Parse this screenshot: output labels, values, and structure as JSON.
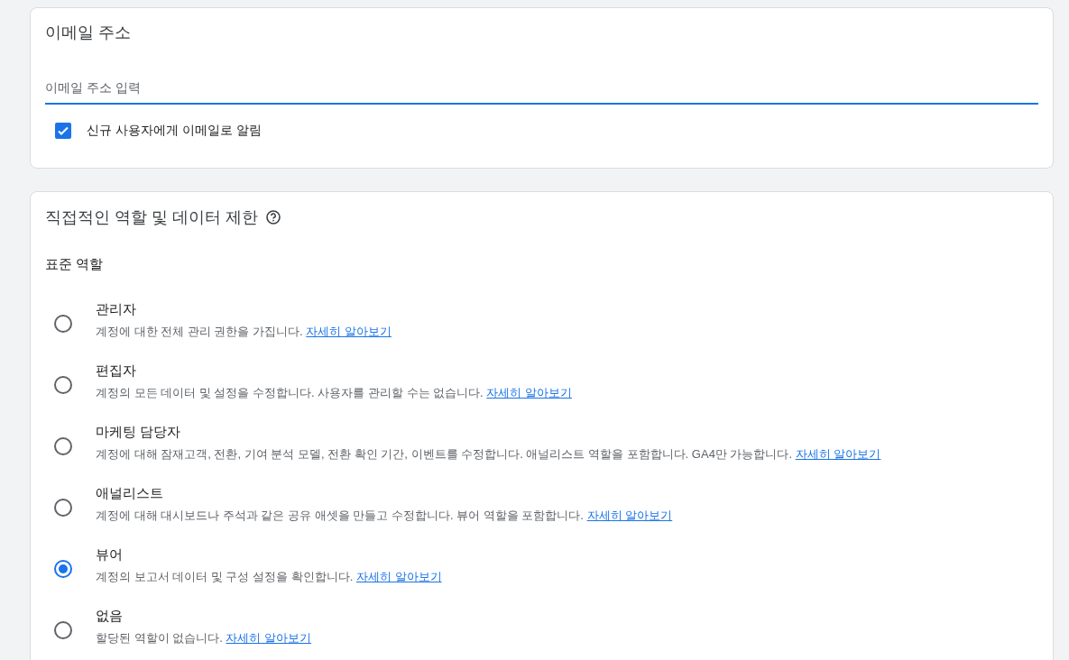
{
  "email_card": {
    "title": "이메일 주소",
    "email_field": {
      "placeholder": "이메일 주소 입력"
    },
    "notify": {
      "label": "신규 사용자에게 이메일로 알림",
      "checked": true
    }
  },
  "roles_card": {
    "title": "직접적인 역할 및 데이터 제한",
    "subtitle": "표준 역할",
    "roles": [
      {
        "name": "관리자",
        "description": "계정에 대한 전체 관리 권한을 가집니다.",
        "link": "자세히 알아보기",
        "selected": false
      },
      {
        "name": "편집자",
        "description": "계정의 모든 데이터 및 설정을 수정합니다. 사용자를 관리할 수는 없습니다.",
        "link": "자세히 알아보기",
        "selected": false
      },
      {
        "name": "마케팅 담당자",
        "description": "계정에 대해 잠재고객, 전환, 기여 분석 모델, 전환 확인 기간, 이벤트를 수정합니다. 애널리스트 역할을 포함합니다. GA4만 가능합니다.",
        "link": "자세히 알아보기",
        "selected": false
      },
      {
        "name": "애널리스트",
        "description": "계정에 대해 대시보드나 주석과 같은 공유 애셋을 만들고 수정합니다. 뷰어 역할을 포함합니다.",
        "link": "자세히 알아보기",
        "selected": false
      },
      {
        "name": "뷰어",
        "description": "계정의 보고서 데이터 및 구성 설정을 확인합니다.",
        "link": "자세히 알아보기",
        "selected": true
      },
      {
        "name": "없음",
        "description": "할당된 역할이 없습니다.",
        "link": "자세히 알아보기",
        "selected": false
      }
    ]
  }
}
